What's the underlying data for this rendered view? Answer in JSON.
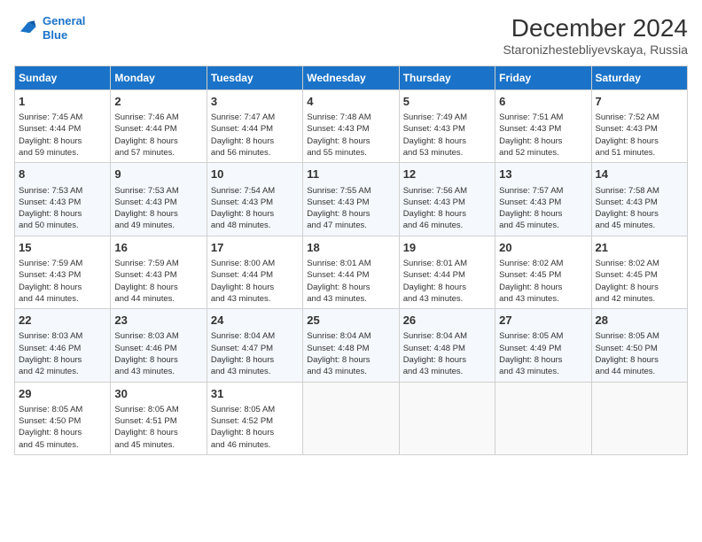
{
  "header": {
    "logo_line1": "General",
    "logo_line2": "Blue",
    "month": "December 2024",
    "location": "Staronizhestebliyevskaya, Russia"
  },
  "weekdays": [
    "Sunday",
    "Monday",
    "Tuesday",
    "Wednesday",
    "Thursday",
    "Friday",
    "Saturday"
  ],
  "weeks": [
    [
      {
        "day": "1",
        "lines": [
          "Sunrise: 7:45 AM",
          "Sunset: 4:44 PM",
          "Daylight: 8 hours",
          "and 59 minutes."
        ]
      },
      {
        "day": "2",
        "lines": [
          "Sunrise: 7:46 AM",
          "Sunset: 4:44 PM",
          "Daylight: 8 hours",
          "and 57 minutes."
        ]
      },
      {
        "day": "3",
        "lines": [
          "Sunrise: 7:47 AM",
          "Sunset: 4:44 PM",
          "Daylight: 8 hours",
          "and 56 minutes."
        ]
      },
      {
        "day": "4",
        "lines": [
          "Sunrise: 7:48 AM",
          "Sunset: 4:43 PM",
          "Daylight: 8 hours",
          "and 55 minutes."
        ]
      },
      {
        "day": "5",
        "lines": [
          "Sunrise: 7:49 AM",
          "Sunset: 4:43 PM",
          "Daylight: 8 hours",
          "and 53 minutes."
        ]
      },
      {
        "day": "6",
        "lines": [
          "Sunrise: 7:51 AM",
          "Sunset: 4:43 PM",
          "Daylight: 8 hours",
          "and 52 minutes."
        ]
      },
      {
        "day": "7",
        "lines": [
          "Sunrise: 7:52 AM",
          "Sunset: 4:43 PM",
          "Daylight: 8 hours",
          "and 51 minutes."
        ]
      }
    ],
    [
      {
        "day": "8",
        "lines": [
          "Sunrise: 7:53 AM",
          "Sunset: 4:43 PM",
          "Daylight: 8 hours",
          "and 50 minutes."
        ]
      },
      {
        "day": "9",
        "lines": [
          "Sunrise: 7:53 AM",
          "Sunset: 4:43 PM",
          "Daylight: 8 hours",
          "and 49 minutes."
        ]
      },
      {
        "day": "10",
        "lines": [
          "Sunrise: 7:54 AM",
          "Sunset: 4:43 PM",
          "Daylight: 8 hours",
          "and 48 minutes."
        ]
      },
      {
        "day": "11",
        "lines": [
          "Sunrise: 7:55 AM",
          "Sunset: 4:43 PM",
          "Daylight: 8 hours",
          "and 47 minutes."
        ]
      },
      {
        "day": "12",
        "lines": [
          "Sunrise: 7:56 AM",
          "Sunset: 4:43 PM",
          "Daylight: 8 hours",
          "and 46 minutes."
        ]
      },
      {
        "day": "13",
        "lines": [
          "Sunrise: 7:57 AM",
          "Sunset: 4:43 PM",
          "Daylight: 8 hours",
          "and 45 minutes."
        ]
      },
      {
        "day": "14",
        "lines": [
          "Sunrise: 7:58 AM",
          "Sunset: 4:43 PM",
          "Daylight: 8 hours",
          "and 45 minutes."
        ]
      }
    ],
    [
      {
        "day": "15",
        "lines": [
          "Sunrise: 7:59 AM",
          "Sunset: 4:43 PM",
          "Daylight: 8 hours",
          "and 44 minutes."
        ]
      },
      {
        "day": "16",
        "lines": [
          "Sunrise: 7:59 AM",
          "Sunset: 4:43 PM",
          "Daylight: 8 hours",
          "and 44 minutes."
        ]
      },
      {
        "day": "17",
        "lines": [
          "Sunrise: 8:00 AM",
          "Sunset: 4:44 PM",
          "Daylight: 8 hours",
          "and 43 minutes."
        ]
      },
      {
        "day": "18",
        "lines": [
          "Sunrise: 8:01 AM",
          "Sunset: 4:44 PM",
          "Daylight: 8 hours",
          "and 43 minutes."
        ]
      },
      {
        "day": "19",
        "lines": [
          "Sunrise: 8:01 AM",
          "Sunset: 4:44 PM",
          "Daylight: 8 hours",
          "and 43 minutes."
        ]
      },
      {
        "day": "20",
        "lines": [
          "Sunrise: 8:02 AM",
          "Sunset: 4:45 PM",
          "Daylight: 8 hours",
          "and 43 minutes."
        ]
      },
      {
        "day": "21",
        "lines": [
          "Sunrise: 8:02 AM",
          "Sunset: 4:45 PM",
          "Daylight: 8 hours",
          "and 42 minutes."
        ]
      }
    ],
    [
      {
        "day": "22",
        "lines": [
          "Sunrise: 8:03 AM",
          "Sunset: 4:46 PM",
          "Daylight: 8 hours",
          "and 42 minutes."
        ]
      },
      {
        "day": "23",
        "lines": [
          "Sunrise: 8:03 AM",
          "Sunset: 4:46 PM",
          "Daylight: 8 hours",
          "and 43 minutes."
        ]
      },
      {
        "day": "24",
        "lines": [
          "Sunrise: 8:04 AM",
          "Sunset: 4:47 PM",
          "Daylight: 8 hours",
          "and 43 minutes."
        ]
      },
      {
        "day": "25",
        "lines": [
          "Sunrise: 8:04 AM",
          "Sunset: 4:48 PM",
          "Daylight: 8 hours",
          "and 43 minutes."
        ]
      },
      {
        "day": "26",
        "lines": [
          "Sunrise: 8:04 AM",
          "Sunset: 4:48 PM",
          "Daylight: 8 hours",
          "and 43 minutes."
        ]
      },
      {
        "day": "27",
        "lines": [
          "Sunrise: 8:05 AM",
          "Sunset: 4:49 PM",
          "Daylight: 8 hours",
          "and 43 minutes."
        ]
      },
      {
        "day": "28",
        "lines": [
          "Sunrise: 8:05 AM",
          "Sunset: 4:50 PM",
          "Daylight: 8 hours",
          "and 44 minutes."
        ]
      }
    ],
    [
      {
        "day": "29",
        "lines": [
          "Sunrise: 8:05 AM",
          "Sunset: 4:50 PM",
          "Daylight: 8 hours",
          "and 45 minutes."
        ]
      },
      {
        "day": "30",
        "lines": [
          "Sunrise: 8:05 AM",
          "Sunset: 4:51 PM",
          "Daylight: 8 hours",
          "and 45 minutes."
        ]
      },
      {
        "day": "31",
        "lines": [
          "Sunrise: 8:05 AM",
          "Sunset: 4:52 PM",
          "Daylight: 8 hours",
          "and 46 minutes."
        ]
      },
      null,
      null,
      null,
      null
    ]
  ]
}
